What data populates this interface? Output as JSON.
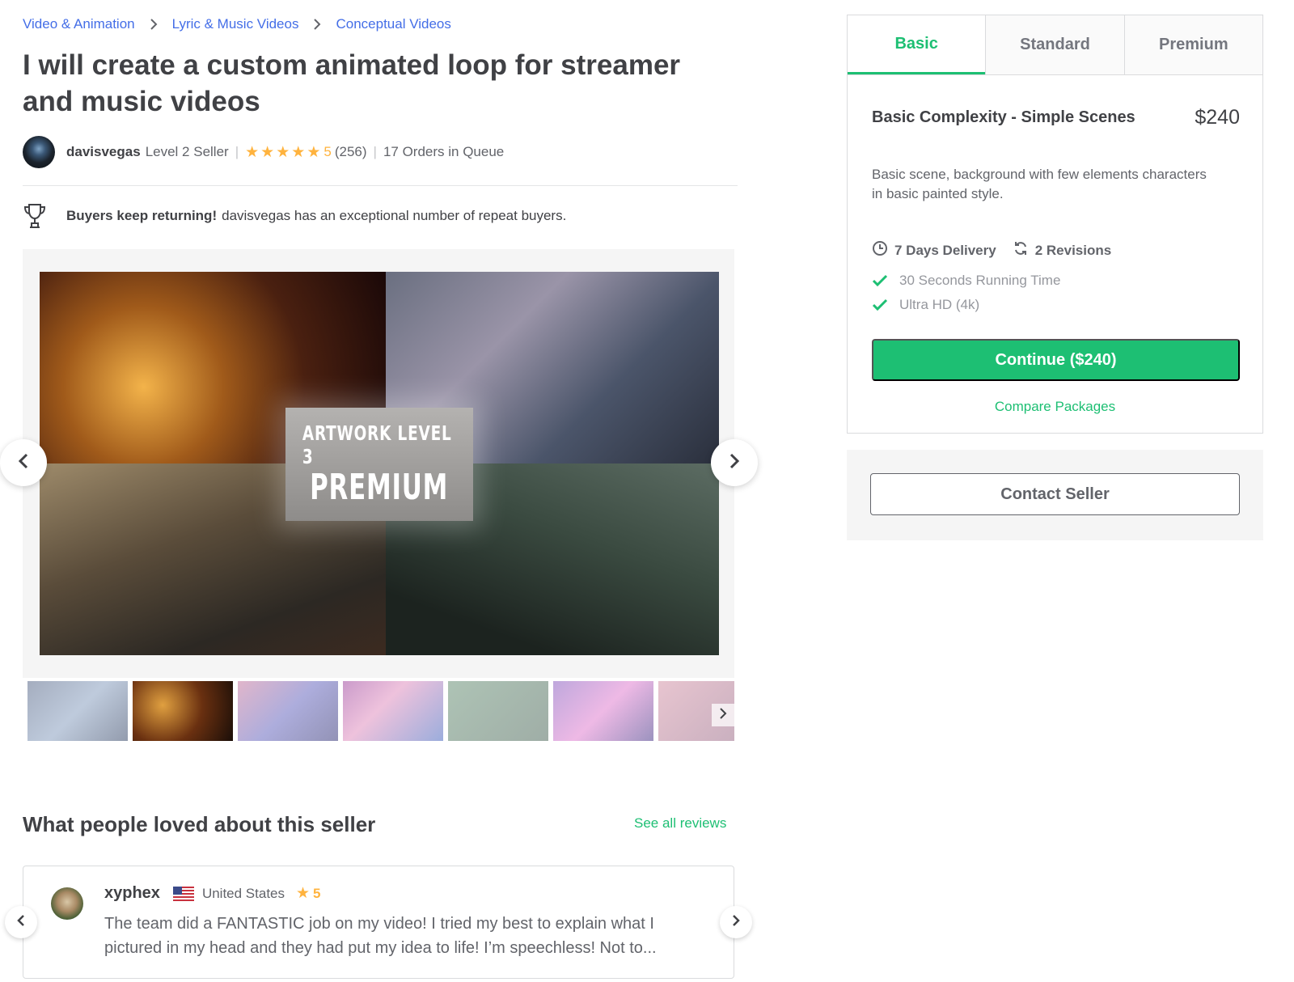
{
  "breadcrumb": {
    "items": [
      "Video & Animation",
      "Lyric & Music Videos",
      "Conceptual Videos"
    ]
  },
  "gig": {
    "title": "I will create a custom animated loop for streamer and music videos"
  },
  "seller": {
    "name": "davisvegas",
    "level": "Level 2 Seller",
    "rating": "5",
    "reviews_count": "(256)",
    "orders_in_queue": "17 Orders in Queue"
  },
  "returning": {
    "bold": "Buyers keep returning!",
    "text": "davisvegas has an exceptional number of repeat buyers."
  },
  "gallery": {
    "overlay_line1": "ARTWORK LEVEL 3",
    "overlay_line2": "PREMIUM",
    "selected_thumb_index": 2
  },
  "reviews": {
    "heading": "What people loved about this seller",
    "see_all": "See all reviews",
    "item": {
      "reviewer": "xyphex",
      "country": "United States",
      "rating": "5",
      "text": "The team did a FANTASTIC job on my video! I tried my best to explain what I pictured in my head and they had put my idea to life! I’m speechless! Not to..."
    }
  },
  "packages": {
    "tabs": [
      "Basic",
      "Standard",
      "Premium"
    ],
    "active_tab": "Basic",
    "name": "Basic Complexity - Simple Scenes",
    "price": "$240",
    "description": "Basic scene, background with few elements characters in basic painted style.",
    "delivery": "7 Days Delivery",
    "revisions": "2 Revisions",
    "features": [
      "30 Seconds Running Time",
      "Ultra HD (4k)"
    ],
    "continue_label": "Continue ($240)",
    "compare_label": "Compare Packages"
  },
  "contact": {
    "label": "Contact Seller"
  },
  "colors": {
    "accent": "#1dbf73",
    "link": "#446ee7",
    "star": "#ffb33e",
    "text": "#404145"
  }
}
